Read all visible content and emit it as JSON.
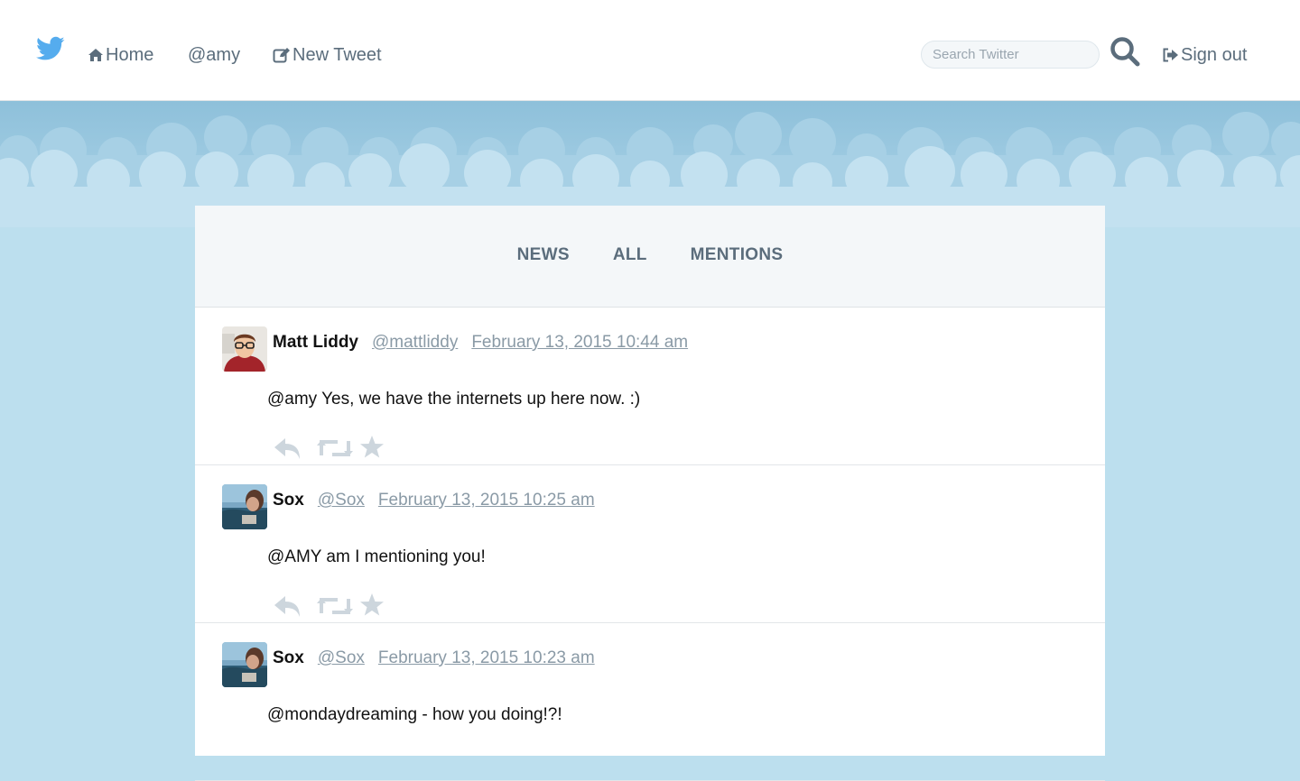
{
  "nav": {
    "logo": "twitter-bird-icon",
    "home_label": "Home",
    "profile_label": "@amy",
    "new_tweet_label": "New Tweet",
    "search_placeholder": "Search Twitter",
    "signout_label": "Sign out"
  },
  "colors": {
    "brand": "#55acee",
    "nav_text": "#5b6d7c",
    "background": "#bcdfee",
    "link_muted": "#8a9aa6"
  },
  "tabs": [
    {
      "label": "NEWS"
    },
    {
      "label": "ALL"
    },
    {
      "label": "MENTIONS"
    }
  ],
  "tweets": [
    {
      "name": "Matt Liddy",
      "handle": "@mattliddy",
      "time": "February 13, 2015 10:44 am",
      "text": "@amy Yes, we have the internets up here now. :)"
    },
    {
      "name": "Sox",
      "handle": "@Sox",
      "time": "February 13, 2015 10:25 am",
      "text": "@AMY am I mentioning you!"
    },
    {
      "name": "Sox",
      "handle": "@Sox",
      "time": "February 13, 2015 10:23 am",
      "text": "@mondaydreaming - how you doing!?!"
    }
  ]
}
